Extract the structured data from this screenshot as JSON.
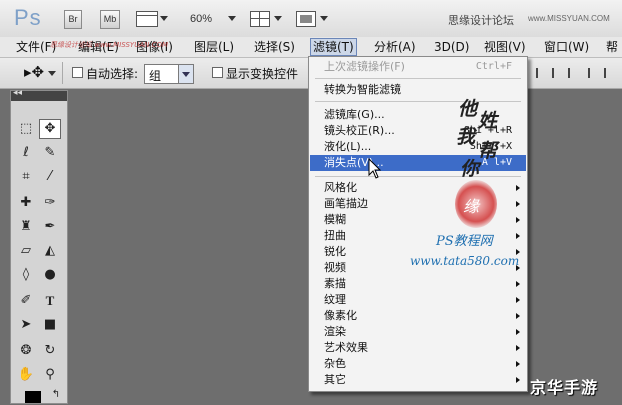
{
  "appbar": {
    "logo": "Ps",
    "bridge": "Br",
    "minibridge": "Mb",
    "zoom": "60%",
    "brand": "思缘设计论坛",
    "brand_url": "www.MISSYUAN.COM"
  },
  "watermark_top": "思缘设计论坛 www.MISSYUAN.COM",
  "menubar": {
    "items": [
      "文件(F)",
      "编辑(E)",
      "图像(I)",
      "图层(L)",
      "选择(S)",
      "滤镜(T)",
      "分析(A)",
      "3D(D)",
      "视图(V)",
      "窗口(W)",
      "帮"
    ]
  },
  "options": {
    "auto_select_label": "自动选择:",
    "auto_select_value": "组",
    "show_transform_label": "显示变换控件"
  },
  "filter_menu": {
    "last_filter": {
      "label": "上次滤镜操作(F)",
      "shortcut": "Ctrl+F"
    },
    "smart": "转换为智能滤镜",
    "group2": [
      {
        "label": "滤镜库(G)...",
        "shortcut": ""
      },
      {
        "label": "镜头校正(R)...",
        "shortcut": "Shi     +l+R"
      },
      {
        "label": "液化(L)...",
        "shortcut": "Shir     +X"
      },
      {
        "label": "消失点(V)...",
        "shortcut": "A      l+V"
      }
    ],
    "submenus": [
      "风格化",
      "画笔描边",
      "模糊",
      "扭曲",
      "锐化",
      "视频",
      "素描",
      "纹理",
      "像素化",
      "渲染",
      "艺术效果",
      "杂色",
      "其它"
    ]
  },
  "overlays": {
    "handwriting": [
      "他",
      "姓",
      "我",
      "帮",
      "你"
    ],
    "seal_text": "缘",
    "site_name": "PS教程网",
    "site_url": "www.tata580.com",
    "corner_text": "京华手游"
  },
  "colors": {
    "highlight": "#3d6cc8",
    "canvas_bg": "#6e6e6e",
    "link_blue": "#1e6fb0"
  }
}
